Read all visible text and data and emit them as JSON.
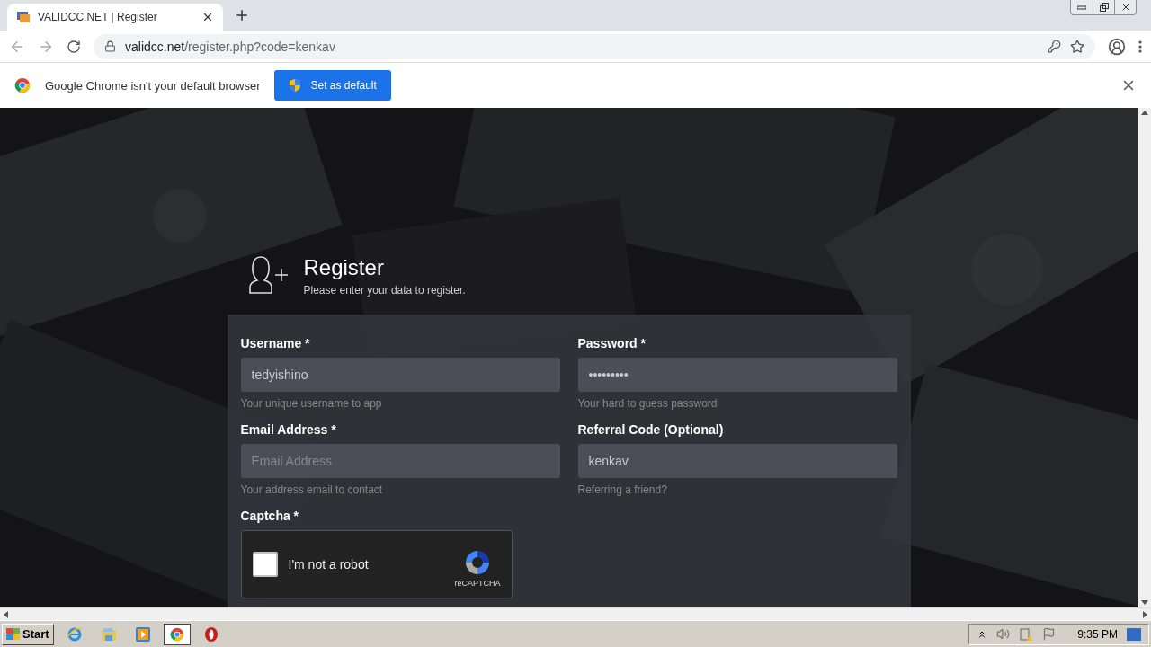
{
  "browser": {
    "tabs": [
      {
        "title": "VALIDCC.NET | Register",
        "selected": true
      }
    ],
    "address": {
      "host": "validcc.net",
      "path": "/register.php?code=kenkav"
    }
  },
  "infobar": {
    "message": "Google Chrome isn't your default browser",
    "button": "Set as default"
  },
  "form": {
    "title": "Register",
    "subtitle": "Please enter your data to register.",
    "fields": [
      {
        "label": "Username *",
        "value": "tedyishino",
        "hint": "Your unique username to app"
      },
      {
        "label": "Password *",
        "value": "•••••••••",
        "hint": "Your hard to guess password"
      },
      {
        "label": "Email Address *",
        "placeholder": "Email Address",
        "hint": "Your address email to contact"
      },
      {
        "label": "Referral Code (Optional)",
        "value": "kenkav",
        "hint": "Referring a friend?"
      }
    ],
    "captcha": {
      "label": "Captcha *",
      "checkbox_label": "I'm not a robot",
      "checked": false,
      "brand": "reCAPTCHA"
    }
  },
  "taskbar": {
    "start": "Start",
    "apps": [
      {
        "kind": "ie",
        "selected": false
      },
      {
        "kind": "explorer",
        "selected": false
      },
      {
        "kind": "media",
        "selected": false
      },
      {
        "kind": "chrome",
        "selected": true
      },
      {
        "kind": "opera",
        "selected": false
      }
    ],
    "clock": "9:35 PM"
  }
}
